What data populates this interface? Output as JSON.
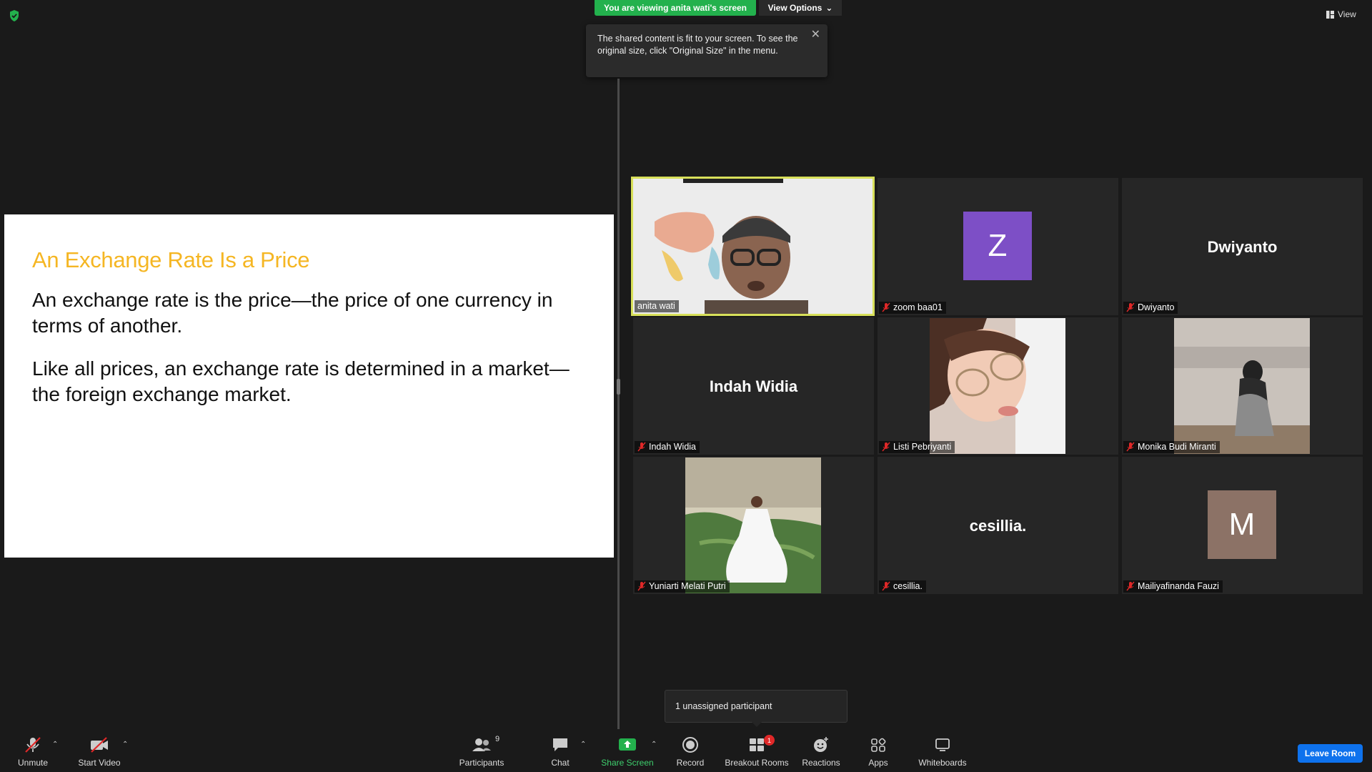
{
  "top": {
    "share_banner": "You are viewing anita wati's screen",
    "view_options": "View Options",
    "view_label": "View",
    "tooltip_text": "The shared content is fit to your screen. To see the original size, click \"Original Size\" in the menu."
  },
  "slide": {
    "title": "An Exchange Rate Is a Price",
    "paragraphs": [
      "An exchange rate is the price—the price of one currency in terms of another.",
      "Like all prices, an exchange rate is determined in a market—the foreign exchange market."
    ]
  },
  "participants": [
    {
      "name": "anita wati",
      "type": "video",
      "muted": false,
      "active": true
    },
    {
      "name": "zoom baa01",
      "type": "avatar",
      "initial": "Z",
      "avatar_color": "#7d4fc6",
      "muted": true
    },
    {
      "name": "Dwiyanto",
      "type": "text",
      "display": "Dwiyanto",
      "muted": true
    },
    {
      "name": "Indah Widia",
      "type": "text",
      "display": "Indah Widia",
      "muted": true
    },
    {
      "name": "Listi Pebriyanti",
      "type": "video",
      "muted": true
    },
    {
      "name": "Monika Budi Miranti",
      "type": "video",
      "muted": true
    },
    {
      "name": "Yuniarti Melati Putri",
      "type": "video",
      "muted": true
    },
    {
      "name": "cesillia.",
      "type": "text",
      "display": "cesillia.",
      "muted": true
    },
    {
      "name": "Mailiyafinanda Fauzi",
      "type": "avatar",
      "initial": "M",
      "avatar_color": "#8c7266",
      "muted": true
    }
  ],
  "toast": "1 unassigned participant",
  "toolbar": {
    "unmute": "Unmute",
    "start_video": "Start Video",
    "participants": "Participants",
    "participants_count": "9",
    "chat": "Chat",
    "share_screen": "Share Screen",
    "record": "Record",
    "breakout_rooms": "Breakout Rooms",
    "breakout_badge": "1",
    "reactions": "Reactions",
    "apps": "Apps",
    "whiteboards": "Whiteboards",
    "leave": "Leave Room"
  },
  "colors": {
    "share_green": "#23b14d",
    "active_border": "#d8e05a",
    "slide_title": "#f5b623",
    "leave_blue": "#0e72ed",
    "mute_red": "#e02828"
  }
}
